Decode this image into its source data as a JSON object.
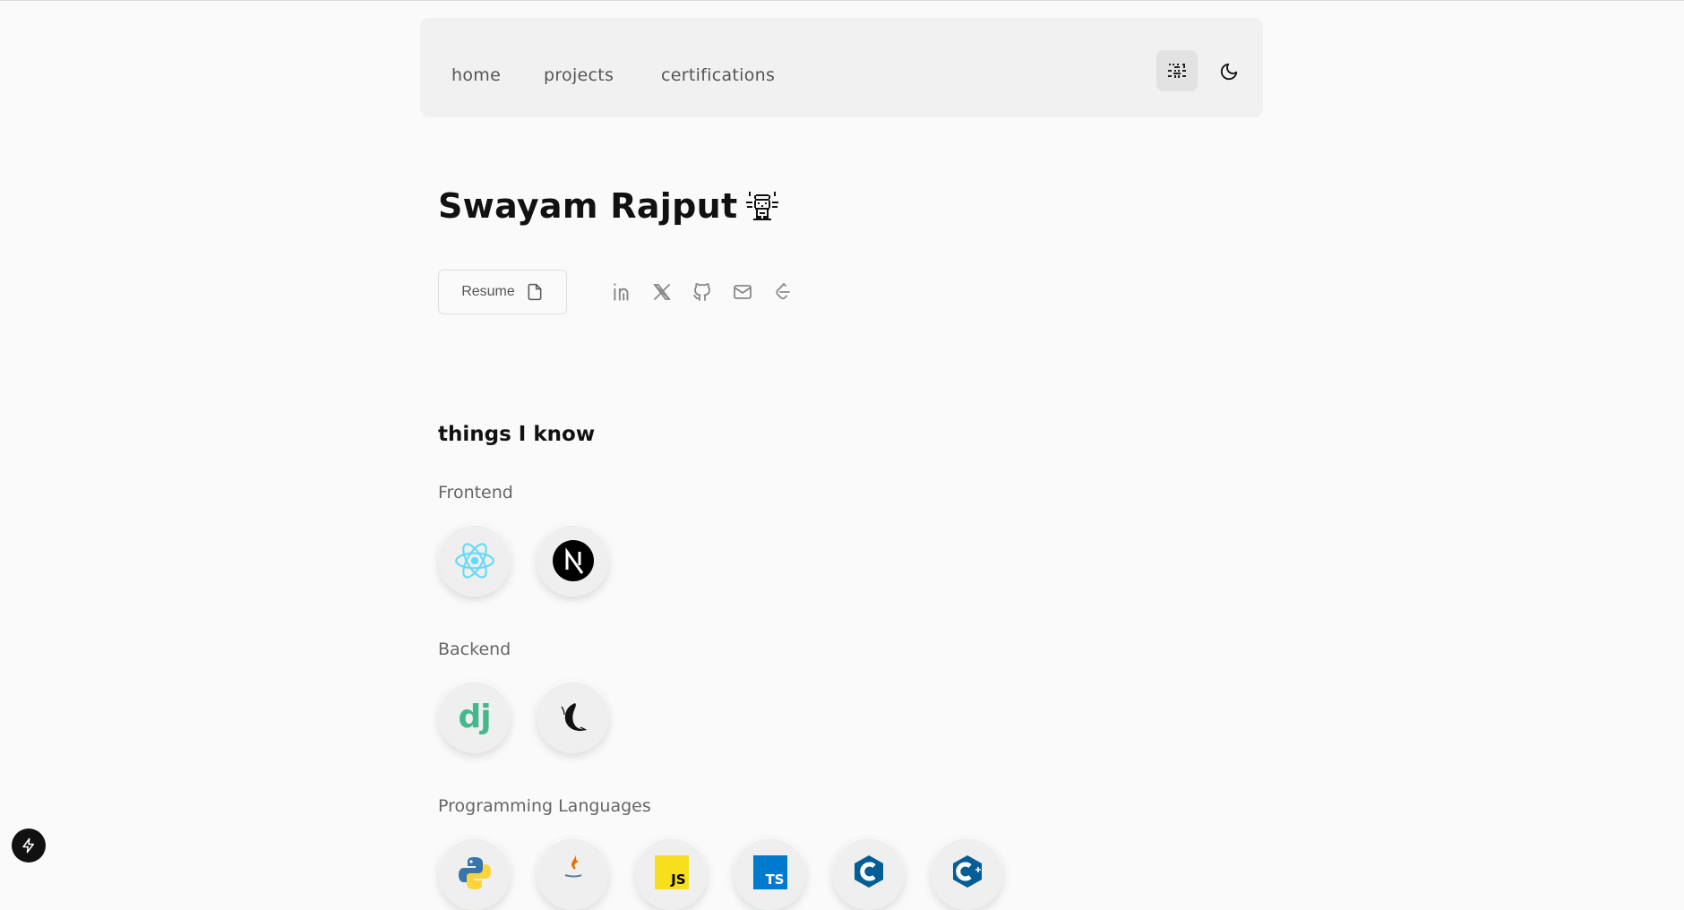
{
  "nav": {
    "links": [
      "home",
      "projects",
      "certifications"
    ],
    "cat_icon": "cat-icon",
    "theme_icon": "moon-icon"
  },
  "hero": {
    "name": "Swayam Rajput",
    "resume_label": "Resume",
    "socials": [
      "linkedin-icon",
      "x-icon",
      "github-icon",
      "mail-icon",
      "leetcode-icon"
    ]
  },
  "skills": {
    "title": "things I know",
    "groups": [
      {
        "label": "Frontend",
        "items": [
          "react-icon",
          "nextjs-icon"
        ]
      },
      {
        "label": "Backend",
        "items": [
          "django-icon",
          "flask-icon"
        ]
      },
      {
        "label": "Programming Languages",
        "items": [
          "python-icon",
          "java-icon",
          "javascript-icon",
          "typescript-icon",
          "c-icon",
          "cpp-icon"
        ]
      }
    ],
    "django_text": "dj",
    "js_text": "JS",
    "ts_text": "TS"
  },
  "colors": {
    "background": "#fafafa",
    "nav_bg": "#f1f1f1",
    "react": "#61dafb",
    "django": "#44b78b"
  }
}
